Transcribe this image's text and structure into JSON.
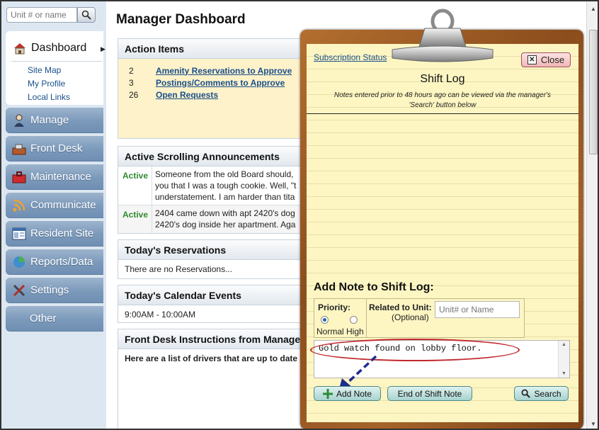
{
  "sidebar": {
    "search_placeholder": "Unit # or name",
    "dashboard_label": "Dashboard",
    "dashboard_links": [
      "Site Map",
      "My Profile",
      "Local Links"
    ],
    "nav": [
      {
        "label": "Manage",
        "icon": "person-icon"
      },
      {
        "label": "Front Desk",
        "icon": "front-desk-icon"
      },
      {
        "label": "Maintenance",
        "icon": "toolbox-icon"
      },
      {
        "label": "Communicate",
        "icon": "broadcast-icon"
      },
      {
        "label": "Resident Site",
        "icon": "website-icon"
      },
      {
        "label": "Reports/Data",
        "icon": "pie-chart-icon"
      },
      {
        "label": "Settings",
        "icon": "tools-icon"
      },
      {
        "label": "Other",
        "icon": ""
      }
    ]
  },
  "main": {
    "title": "Manager Dashboard",
    "action_items": {
      "header": "Action Items",
      "rows": [
        {
          "count": "2",
          "label": "Amenity Reservations to Approve"
        },
        {
          "count": "3",
          "label": "Postings/Comments to Approve"
        },
        {
          "count": "26",
          "label": "Open Requests"
        }
      ]
    },
    "announcements": {
      "header": "Active Scrolling Announcements",
      "rows": [
        {
          "status": "Active",
          "lines": [
            "Someone from the old Board should,",
            "you that I was a tough cookie. Well, \"t",
            "understatement. I am harder than tita"
          ]
        },
        {
          "status": "Active",
          "lines": [
            "2404 came down with apt 2420's dog",
            "2420's dog inside her apartment. Aga"
          ]
        }
      ]
    },
    "reservations": {
      "header": "Today's Reservations",
      "body": "There are no Reservations..."
    },
    "calendar": {
      "header": "Today's Calendar Events",
      "body": "9:00AM - 10:00AM"
    },
    "instructions": {
      "header": "Front Desk Instructions from Manage",
      "body": "Here are a list of drivers that are up to date i"
    }
  },
  "shift_log": {
    "subscription_link": "Subscription Status",
    "close_label": "Close",
    "title": "Shift Log",
    "note_line1": "Notes entered prior to 48 hours ago can be viewed via the manager's",
    "note_line2": "'Search' button below",
    "add_title": "Add Note to Shift Log:",
    "priority_label": "Priority:",
    "priority_normal": "Normal",
    "priority_high": "High",
    "priority_selected": "Normal",
    "related_label": "Related to Unit:",
    "related_optional": "(Optional)",
    "unit_placeholder": "Unit# or Name",
    "note_value": "Gold watch found on lobby floor.",
    "add_note_label": "Add Note",
    "end_shift_label": "End of Shift Note",
    "search_label": "Search"
  },
  "colors": {
    "highlight_ellipse": "#c0282c",
    "arrow": "#1d2c8f",
    "active_status": "#2e8b2e",
    "link": "#1a4f8a"
  }
}
